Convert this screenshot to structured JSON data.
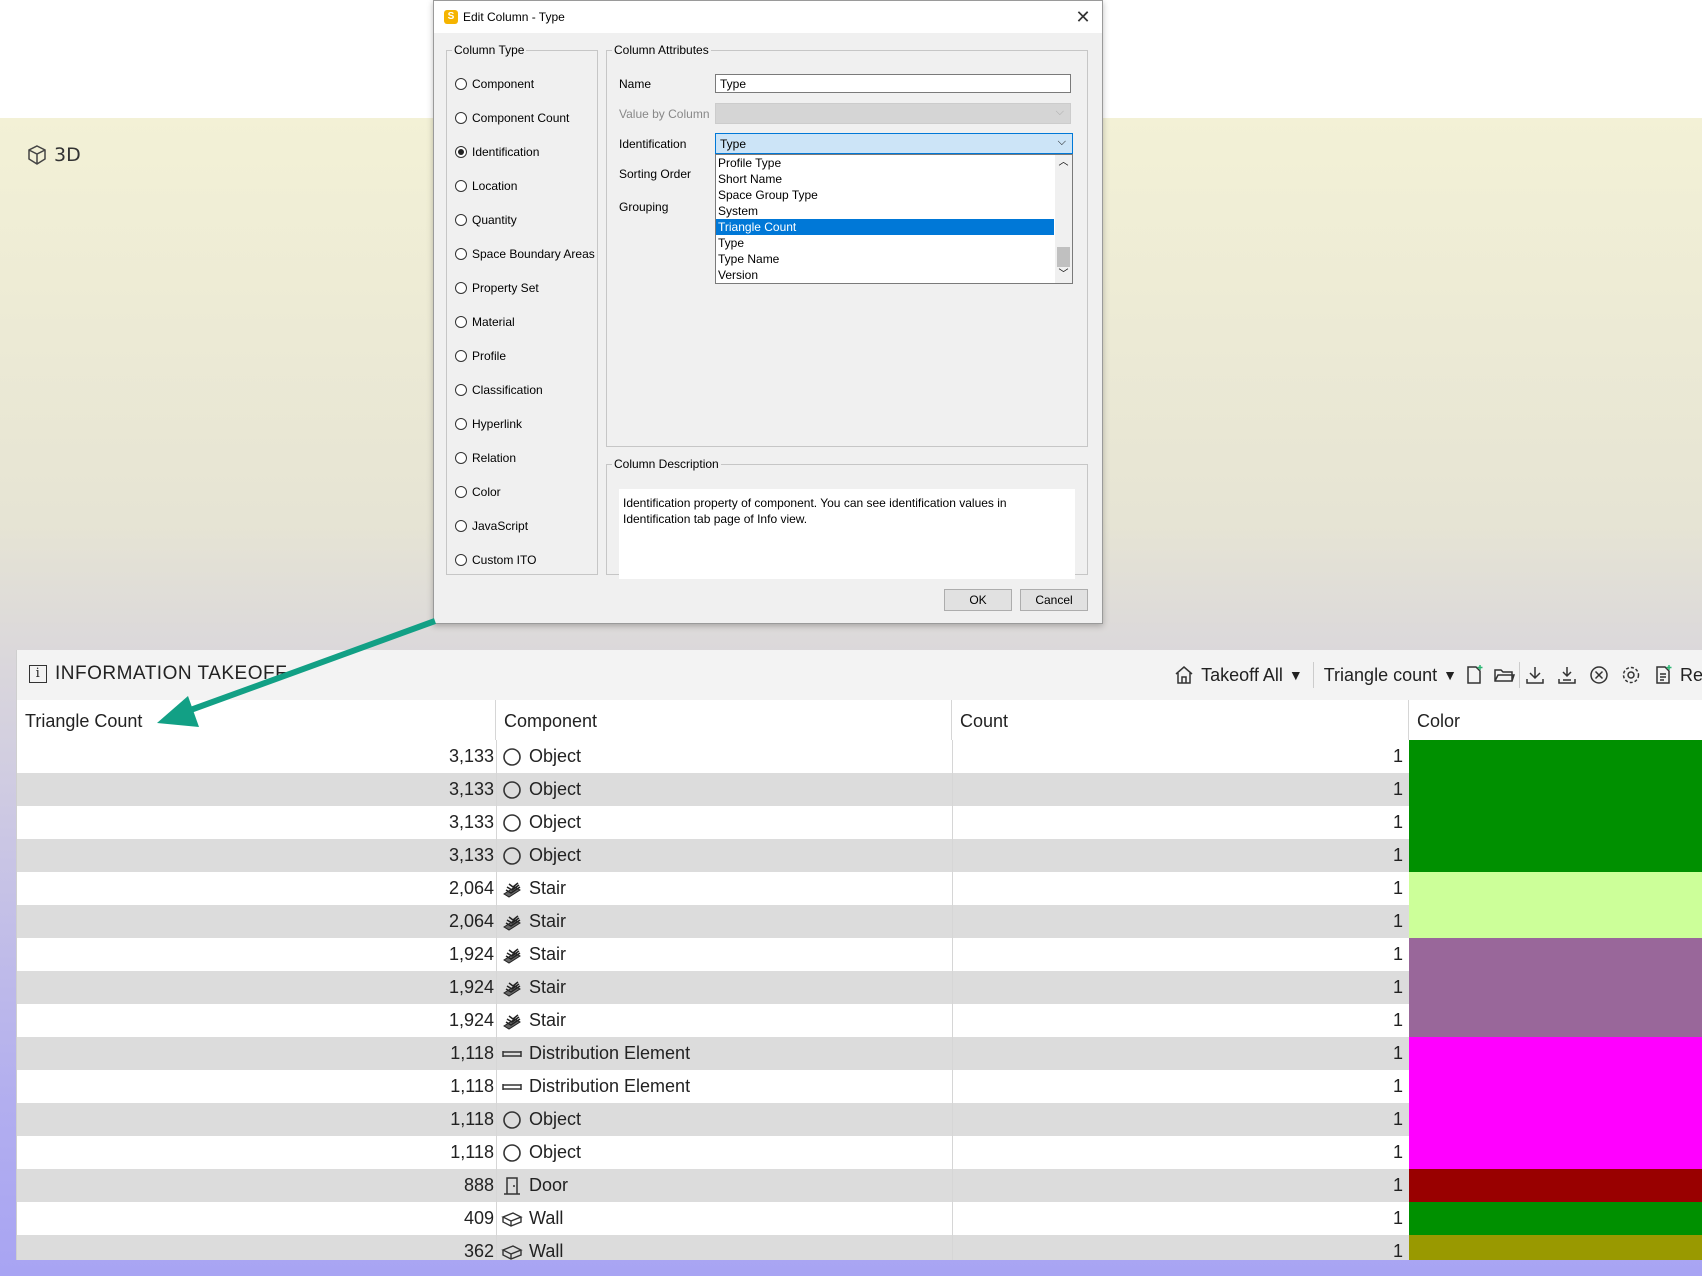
{
  "viewport": {
    "label": "3D"
  },
  "dialog": {
    "title": "Edit Column - Type",
    "column_type": {
      "legend": "Column Type",
      "options": [
        "Component",
        "Component Count",
        "Identification",
        "Location",
        "Quantity",
        "Space Boundary Areas",
        "Property Set",
        "Material",
        "Profile",
        "Classification",
        "Hyperlink",
        "Relation",
        "Color",
        "JavaScript",
        "Custom ITO"
      ],
      "selected": "Identification"
    },
    "column_attributes": {
      "legend": "Column Attributes",
      "name_label": "Name",
      "name_value": "Type",
      "value_by_column_label": "Value by Column",
      "identification_label": "Identification",
      "identification_value": "Type",
      "sorting_order_label": "Sorting Order",
      "grouping_label": "Grouping",
      "dropdown_items": [
        "Profile Type",
        "Short Name",
        "Space Group Type",
        "System",
        "Triangle Count",
        "Type",
        "Type Name",
        "Version"
      ],
      "dropdown_selected": "Triangle Count"
    },
    "column_description": {
      "legend": "Column Description",
      "line1": "Identification property of component. You can see identification values in",
      "line2": "Identification tab page of Info view."
    },
    "ok_label": "OK",
    "cancel_label": "Cancel"
  },
  "panel": {
    "title": "INFORMATION TAKEOFF",
    "toolbar": {
      "takeoff_label": "Takeoff All",
      "preset_label": "Triangle count",
      "trailing_label": "Re"
    },
    "columns": [
      "Triangle Count",
      "Component",
      "Count",
      "Color"
    ],
    "rows": [
      {
        "tri": "3,133",
        "icon": "object-icon",
        "comp": "Object",
        "count": "1",
        "color": "#009000"
      },
      {
        "tri": "3,133",
        "icon": "object-icon",
        "comp": "Object",
        "count": "1",
        "color": "#009000"
      },
      {
        "tri": "3,133",
        "icon": "object-icon",
        "comp": "Object",
        "count": "1",
        "color": "#009000"
      },
      {
        "tri": "3,133",
        "icon": "object-icon",
        "comp": "Object",
        "count": "1",
        "color": "#009000"
      },
      {
        "tri": "2,064",
        "icon": "stair-icon",
        "comp": "Stair",
        "count": "1",
        "color": "#ccff99"
      },
      {
        "tri": "2,064",
        "icon": "stair-icon",
        "comp": "Stair",
        "count": "1",
        "color": "#ccff99"
      },
      {
        "tri": "1,924",
        "icon": "stair-icon",
        "comp": "Stair",
        "count": "1",
        "color": "#99679a"
      },
      {
        "tri": "1,924",
        "icon": "stair-icon",
        "comp": "Stair",
        "count": "1",
        "color": "#99679a"
      },
      {
        "tri": "1,924",
        "icon": "stair-icon",
        "comp": "Stair",
        "count": "1",
        "color": "#99679a"
      },
      {
        "tri": "1,118",
        "icon": "distribution-element-icon",
        "comp": "Distribution Element",
        "count": "1",
        "color": "#ff00ff"
      },
      {
        "tri": "1,118",
        "icon": "distribution-element-icon",
        "comp": "Distribution Element",
        "count": "1",
        "color": "#ff00ff"
      },
      {
        "tri": "1,118",
        "icon": "object-icon",
        "comp": "Object",
        "count": "1",
        "color": "#ff00ff"
      },
      {
        "tri": "1,118",
        "icon": "object-icon",
        "comp": "Object",
        "count": "1",
        "color": "#ff00ff"
      },
      {
        "tri": "888",
        "icon": "door-icon",
        "comp": "Door",
        "count": "1",
        "color": "#990000"
      },
      {
        "tri": "409",
        "icon": "wall-icon",
        "comp": "Wall",
        "count": "1",
        "color": "#009000"
      },
      {
        "tri": "362",
        "icon": "wall-icon",
        "comp": "Wall",
        "count": "1",
        "color": "#999900"
      }
    ]
  },
  "colors": {
    "accent": "#0078d7",
    "arrow": "#12a085"
  }
}
